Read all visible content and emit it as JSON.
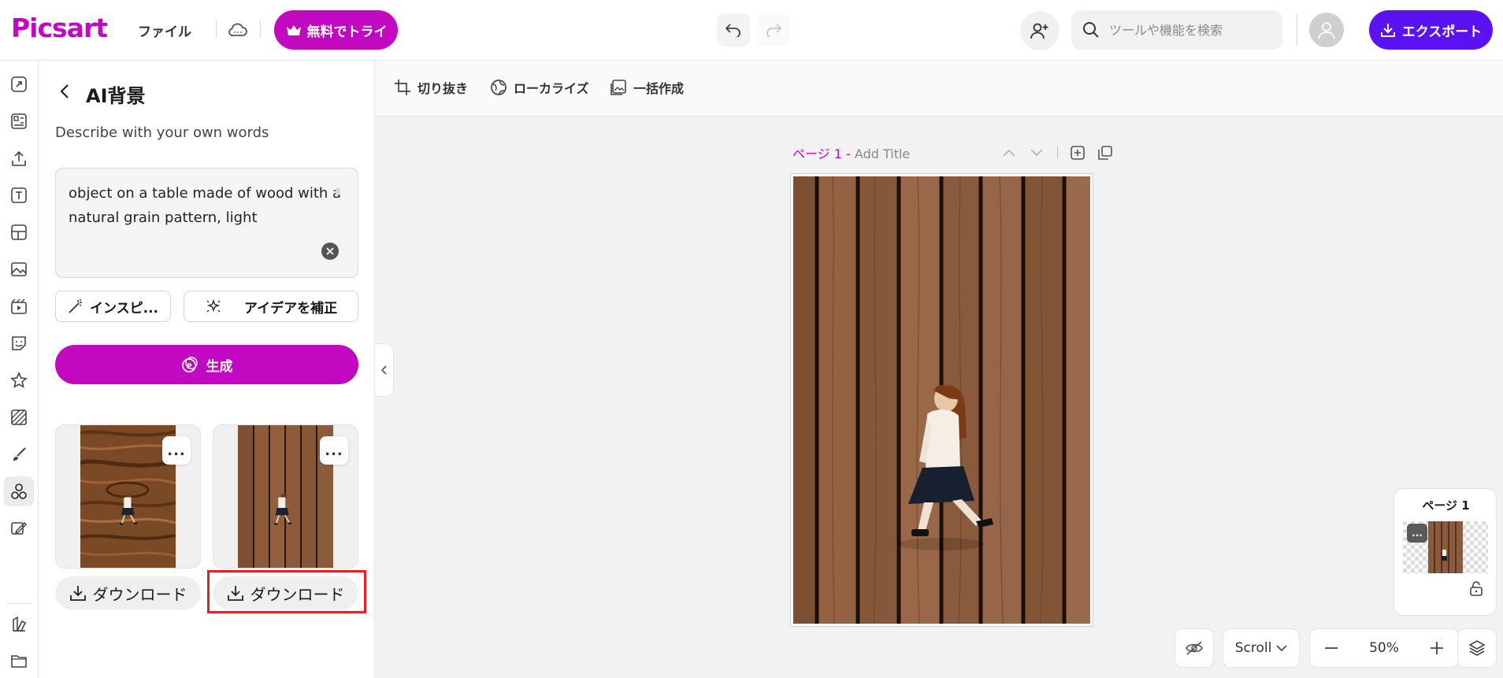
{
  "topbar": {
    "logo_text": "Picsart",
    "file_menu_label": "ファイル",
    "try_button_label": "無料でトライ",
    "search_placeholder": "ツールや機能を検索",
    "export_button_label": "エクスポート",
    "icons": [
      "crown-icon",
      "cloud-icon",
      "undo-icon",
      "redo-icon",
      "add-person-icon",
      "search-icon",
      "user-icon",
      "download-icon"
    ]
  },
  "rail": {
    "icons": [
      "resize-icon",
      "templates-icon",
      "upload-icon",
      "text-icon",
      "layout-icon",
      "photos-icon",
      "video-icon",
      "stickers-icon",
      "favorites-icon",
      "backgrounds-icon",
      "draw-icon",
      "ai-tools-icon",
      "brand-kit-icon",
      "palette-icon",
      "folder-icon"
    ],
    "active_index": 11
  },
  "panel": {
    "title": "AI背景",
    "describe_label": "Describe with your own words",
    "prompt_value": "object on a table made of wood with a natural grain pattern, light",
    "inspire_label": "インスピ...",
    "idea_label": "アイデアを補正",
    "generate_label": "生成",
    "results": [
      {
        "download_label": "ダウンロード",
        "more_label": "..."
      },
      {
        "download_label": "ダウンロード",
        "more_label": "..."
      }
    ]
  },
  "canvas_toolbar": {
    "crop_label": "切り抜き",
    "localize_label": "ローカライズ",
    "batch_label": "一括作成"
  },
  "canvas": {
    "page_prefix": "ページ 1 -",
    "page_title_placeholder": "Add Title"
  },
  "pages_panel": {
    "title": "ページ 1",
    "more_label": "..."
  },
  "bottom_controls": {
    "scroll_mode": "Scroll",
    "zoom_level": "50%"
  },
  "colors": {
    "brand": "#c209c1",
    "export": "#5a12f0",
    "highlight": "#e0202a",
    "wood": "#8a5a3c"
  }
}
